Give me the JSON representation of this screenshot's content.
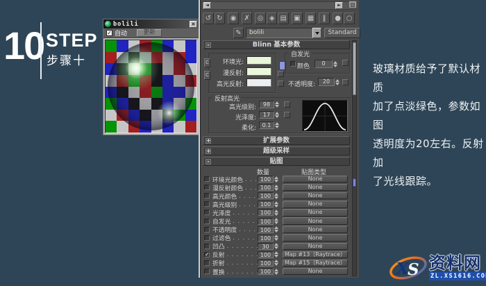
{
  "step": {
    "number": "10",
    "en": "STEP",
    "cn": "步骤十"
  },
  "preview_window": {
    "title": "bolili",
    "close_glyph": "×",
    "check_glyph": "✓",
    "auto_label": "自动",
    "update_label": "更新",
    "checker_rows": [
      "GBARGBAB",
      "RAKARARB",
      "BKAGKARA",
      "ARGRKBAR",
      "BKARGBBA",
      "GBKAKBAG",
      "ARBKAKGB",
      "GARBABAR"
    ],
    "checker_colors": {
      "G": "#079307",
      "B": "#2024c0",
      "A": "#c6c6c6",
      "R": "#a31f1f",
      "K": "#161616"
    }
  },
  "editor": {
    "scroll_left_glyph": "◄",
    "scroll_right_glyph": "►",
    "corner_icon_glyph": "▨",
    "toolbar_icons": [
      {
        "name": "get-material",
        "glyph": "↺",
        "sep": false
      },
      {
        "name": "put-to-scene",
        "glyph": "↻",
        "sep": true
      },
      {
        "name": "assign-to-selection",
        "glyph": "◉",
        "sep": true
      },
      {
        "name": "reset-map",
        "glyph": "✗",
        "sep": true
      },
      {
        "name": "make-copy",
        "glyph": "◎",
        "sep": false
      },
      {
        "name": "make-unique",
        "glyph": "◈",
        "sep": false
      },
      {
        "name": "put-to-library",
        "glyph": "▤",
        "sep": true
      },
      {
        "name": "material-id-channel",
        "glyph": "▣",
        "sep": true
      },
      {
        "name": "show-map-in-viewport",
        "glyph": "▦",
        "sep": true
      },
      {
        "name": "show-end-result",
        "glyph": "‖",
        "sep": true
      },
      {
        "name": "go-to-parent",
        "glyph": "●",
        "sep": false
      },
      {
        "name": "go-forward",
        "glyph": "○",
        "sep": false
      }
    ],
    "eyedropper_glyph": "✎",
    "material_name": "bolili",
    "type_button_label": "Standard",
    "basic": {
      "title": "Blinn 基本参数",
      "collapse_glyph": "-",
      "ambient_label": "环境光:",
      "diffuse_label": "漫反射:",
      "specular_label": "高光反射:",
      "ambient_color": "#e9f6d9",
      "diffuse_color": "#eaf7dc",
      "specular_color": "#eceef0",
      "selfillum_legend": "自发光",
      "color_label": "颜色",
      "selfillum_value": "0",
      "opacity_label": "不透明度:",
      "opacity_value": "20",
      "highlight_legend": "反射高光",
      "spec_level_label": "高光级别:",
      "spec_level_value": "98",
      "gloss_label": "光泽度:",
      "gloss_value": "17",
      "soften_label": "柔化:",
      "soften_value": "0.1"
    },
    "rollouts": [
      {
        "state": "+",
        "title": "扩展参数"
      },
      {
        "state": "+",
        "title": "超级采样"
      }
    ],
    "maps": {
      "state": "-",
      "title": "贴图",
      "amount_header": "数量",
      "type_header": "贴图类型",
      "check_glyph": "✓",
      "rows": [
        {
          "checked": false,
          "label": "环境光颜色",
          "dots": ". . .",
          "amount": "100",
          "map": "None"
        },
        {
          "checked": false,
          "label": "漫反射颜色",
          "dots": ". . .",
          "amount": "100",
          "map": "None"
        },
        {
          "checked": false,
          "label": "高光颜色",
          "dots": ". . . .",
          "amount": "100",
          "map": "None"
        },
        {
          "checked": false,
          "label": "高光级别",
          "dots": ". . . .",
          "amount": "100",
          "map": "None"
        },
        {
          "checked": false,
          "label": "光泽度",
          "dots": ". . . . . .",
          "amount": "100",
          "map": "None"
        },
        {
          "checked": false,
          "label": "自发光",
          "dots": ". . . . . .",
          "amount": "100",
          "map": "None"
        },
        {
          "checked": false,
          "label": "不透明度",
          "dots": ". . . .",
          "amount": "100",
          "map": "None"
        },
        {
          "checked": false,
          "label": "过滤色",
          "dots": ". . . . . .",
          "amount": "100",
          "map": "None"
        },
        {
          "checked": false,
          "label": "凹凸",
          "dots": ". . . . . . . .",
          "amount": "30",
          "map": "None"
        },
        {
          "checked": true,
          "label": "反射",
          "dots": ". . . . . . . .",
          "amount": "100",
          "map": "Map #13（Raytrace）"
        },
        {
          "checked": false,
          "label": "折射",
          "dots": ". . . . . . . .",
          "amount": "100",
          "map": "Map #15（Raytrace）"
        },
        {
          "checked": false,
          "label": "置换",
          "dots": ". . . . . . . .",
          "amount": "100",
          "map": "None"
        }
      ]
    }
  },
  "annotation": {
    "lines": [
      "玻璃材质给予了默认材质",
      "加了点淡绿色，参数如图",
      "透明度为20左右。反射加",
      "了光线跟踪。"
    ]
  },
  "watermark": {
    "xs_x": "X",
    "xs_s": "S",
    "name": "资料网",
    "url": "ZL.XS1616.COM"
  }
}
